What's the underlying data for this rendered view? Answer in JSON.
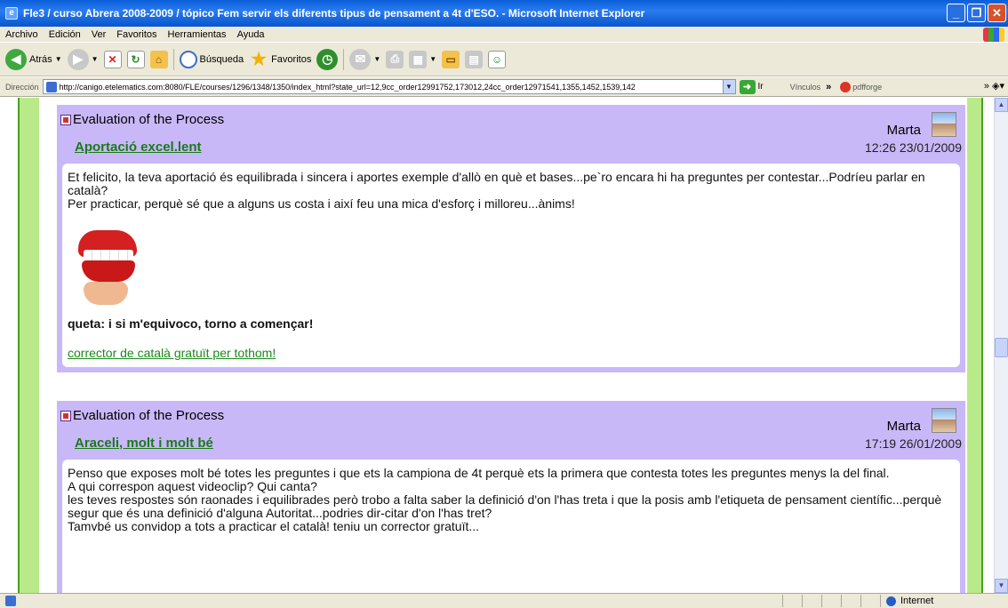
{
  "window": {
    "title": "Fle3 / curso Abrera 2008-2009 / tópico Fem servir els diferents tipus de pensament a 4t d'ESO. - Microsoft Internet Explorer"
  },
  "menu": [
    "Archivo",
    "Edición",
    "Ver",
    "Favoritos",
    "Herramientas",
    "Ayuda"
  ],
  "toolbar": {
    "back": "Atrás",
    "search": "Búsqueda",
    "favorites": "Favoritos"
  },
  "address": {
    "label": "Dirección",
    "url": "http://canigo.etelematics.com:8080/FLE/courses/1296/1348/1350/index_html?state_url=12,9cc_order12991752,173012,24cc_order12971541,1355,1452,1539,142",
    "go": "Ir",
    "links": "Vínculos",
    "pdfforge": "pdfforge"
  },
  "posts": [
    {
      "category": "Evaluation of the Process",
      "author": "Marta",
      "subject": "Aportació excel.lent",
      "date": "12:26 23/01/2009",
      "body": [
        "Et felicito, la teva aportació és equilibrada i sincera i aportes exemple d'allò en què et bases...pe`ro encara hi ha preguntes per contestar...Podríeu parlar en català?",
        "Per practicar, perquè sé que a alguns us costa i així feu una mica d'esforç i milloreu...ànims!"
      ],
      "caption": "queta: i si m'equivoco, torno a començar!",
      "link": "corrector de català gratuït per tothom!"
    },
    {
      "category": "Evaluation of the Process",
      "author": "Marta",
      "subject": "Araceli, molt i molt bé",
      "date": "17:19 26/01/2009",
      "body": [
        "Penso que exposes molt bé totes les preguntes i que ets la campiona de 4t perquè ets la primera que contesta totes les preguntes menys la del final.",
        "A qui correspon aquest videoclip? Qui canta?",
        "les teves respostes són raonades i equilibrades però trobo a falta saber la definició d'on l'has treta i que la posis amb l'etiqueta de pensament científic...perquè segur que és una definició d'alguna Autoritat...podries dir-citar d'on l'has tret?",
        "Tamvbé us convidop a tots a practicar el català! teniu un corrector gratuït..."
      ]
    }
  ],
  "status": {
    "zone": "Internet"
  },
  "colors": {
    "post_header": "#c9b8f8",
    "frame_green": "#b9ea8a",
    "link_green": "#1a7a1a"
  }
}
